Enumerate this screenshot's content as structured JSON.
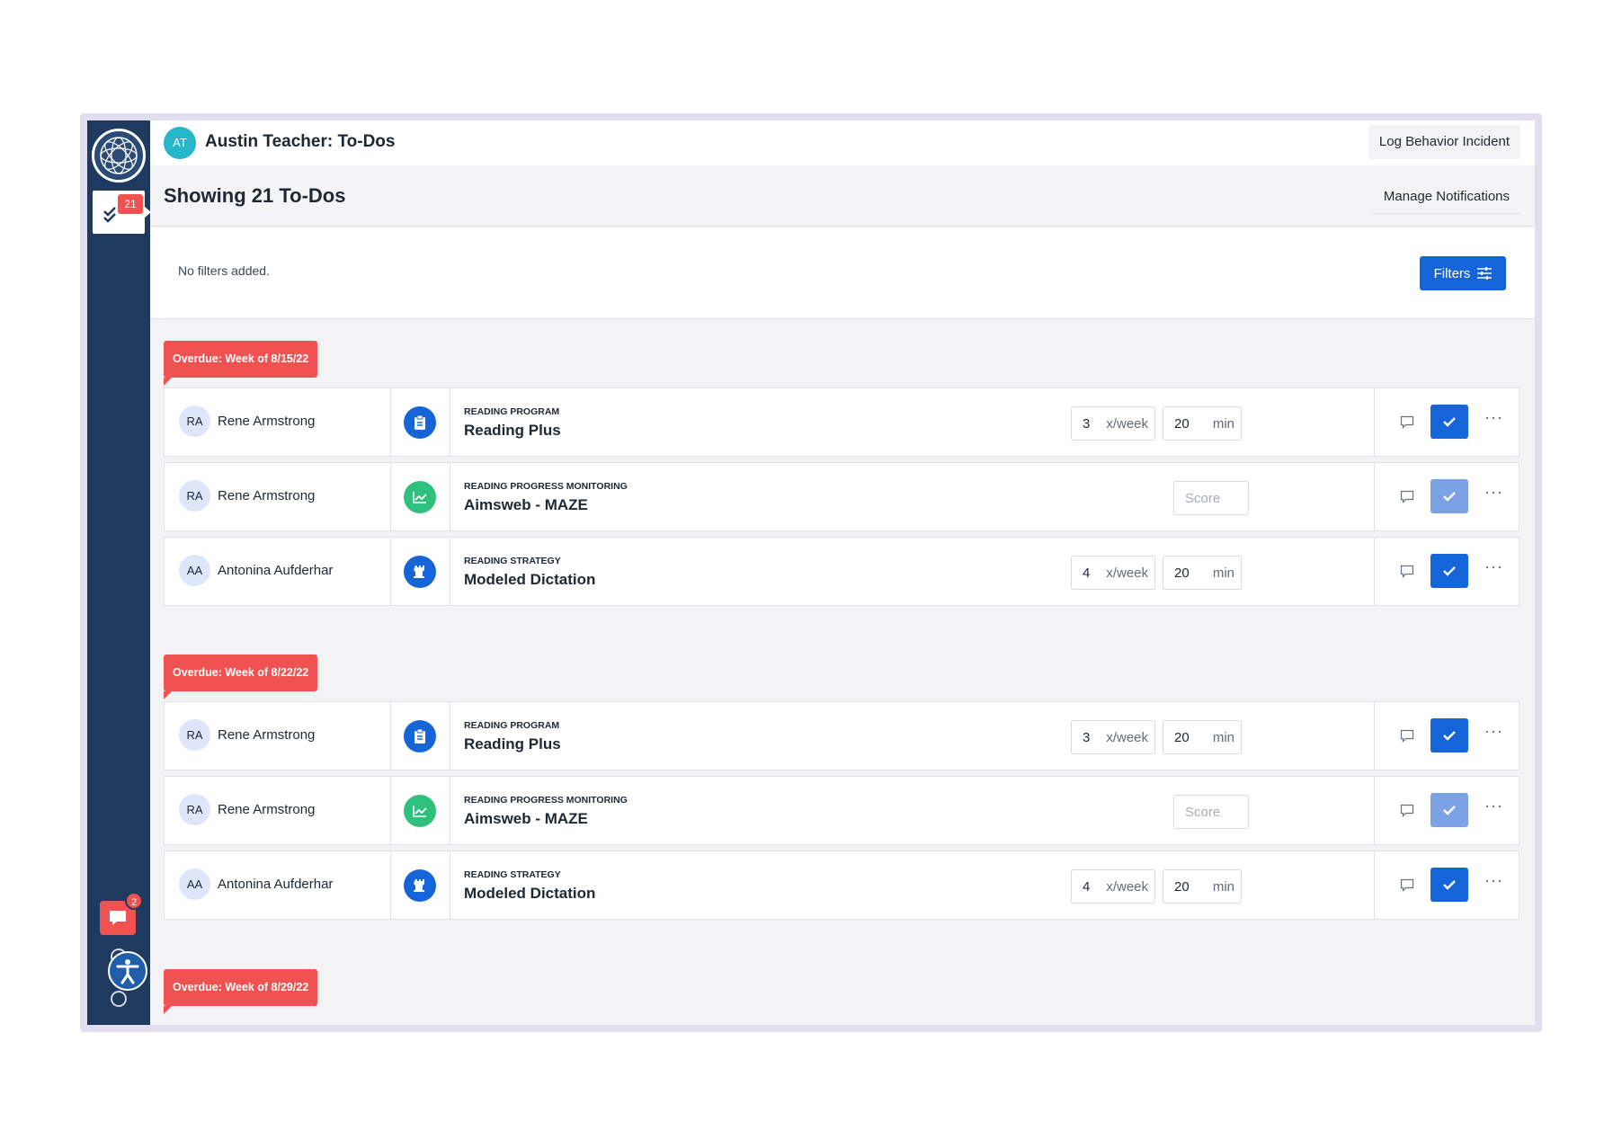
{
  "header": {
    "avatar_initials": "AT",
    "title": "Austin Teacher: To-Dos",
    "log_behavior_label": "Log Behavior Incident"
  },
  "subheader": {
    "showing_text": "Showing 21 To-Dos",
    "manage_notifications_label": "Manage Notifications"
  },
  "filters": {
    "empty_text": "No filters added.",
    "button_label": "Filters"
  },
  "sidebar": {
    "todo_badge": "21",
    "chat_badge": "2",
    "icons": [
      "logo-icon",
      "checkmarks-icon",
      "chat-icon",
      "accessibility-icon"
    ]
  },
  "groups": [
    {
      "label": "Overdue: Week of 8/15/22",
      "rows": [
        {
          "initials": "RA",
          "student": "Rene Armstrong",
          "icon": "clipboard-icon",
          "icon_color": "#1565d8",
          "category": "READING PROGRAM",
          "title": "Reading Plus",
          "freq": "3",
          "freq_unit": "x/week",
          "duration": "20",
          "duration_unit": "min",
          "check_enabled": true
        },
        {
          "initials": "RA",
          "student": "Rene Armstrong",
          "icon": "chart-icon",
          "icon_color": "#2fc07d",
          "category": "READING PROGRESS MONITORING",
          "title": "Aimsweb - MAZE",
          "score_placeholder": "Score",
          "check_enabled": false
        },
        {
          "initials": "AA",
          "student": "Antonina Aufderhar",
          "icon": "strategy-icon",
          "icon_color": "#1565d8",
          "category": "READING STRATEGY",
          "title": "Modeled Dictation",
          "freq": "4",
          "freq_unit": "x/week",
          "duration": "20",
          "duration_unit": "min",
          "check_enabled": true
        }
      ]
    },
    {
      "label": "Overdue: Week of 8/22/22",
      "rows": [
        {
          "initials": "RA",
          "student": "Rene Armstrong",
          "icon": "clipboard-icon",
          "icon_color": "#1565d8",
          "category": "READING PROGRAM",
          "title": "Reading Plus",
          "freq": "3",
          "freq_unit": "x/week",
          "duration": "20",
          "duration_unit": "min",
          "check_enabled": true
        },
        {
          "initials": "RA",
          "student": "Rene Armstrong",
          "icon": "chart-icon",
          "icon_color": "#2fc07d",
          "category": "READING PROGRESS MONITORING",
          "title": "Aimsweb - MAZE",
          "score_placeholder": "Score",
          "check_enabled": false
        },
        {
          "initials": "AA",
          "student": "Antonina Aufderhar",
          "icon": "strategy-icon",
          "icon_color": "#1565d8",
          "category": "READING STRATEGY",
          "title": "Modeled Dictation",
          "freq": "4",
          "freq_unit": "x/week",
          "duration": "20",
          "duration_unit": "min",
          "check_enabled": true
        }
      ]
    },
    {
      "label": "Overdue: Week of 8/29/22",
      "rows": []
    }
  ],
  "colors": {
    "sidebar": "#1f3a5e",
    "accent": "#1565d8",
    "overdue": "#f05252",
    "monitoring": "#2fc07d"
  }
}
